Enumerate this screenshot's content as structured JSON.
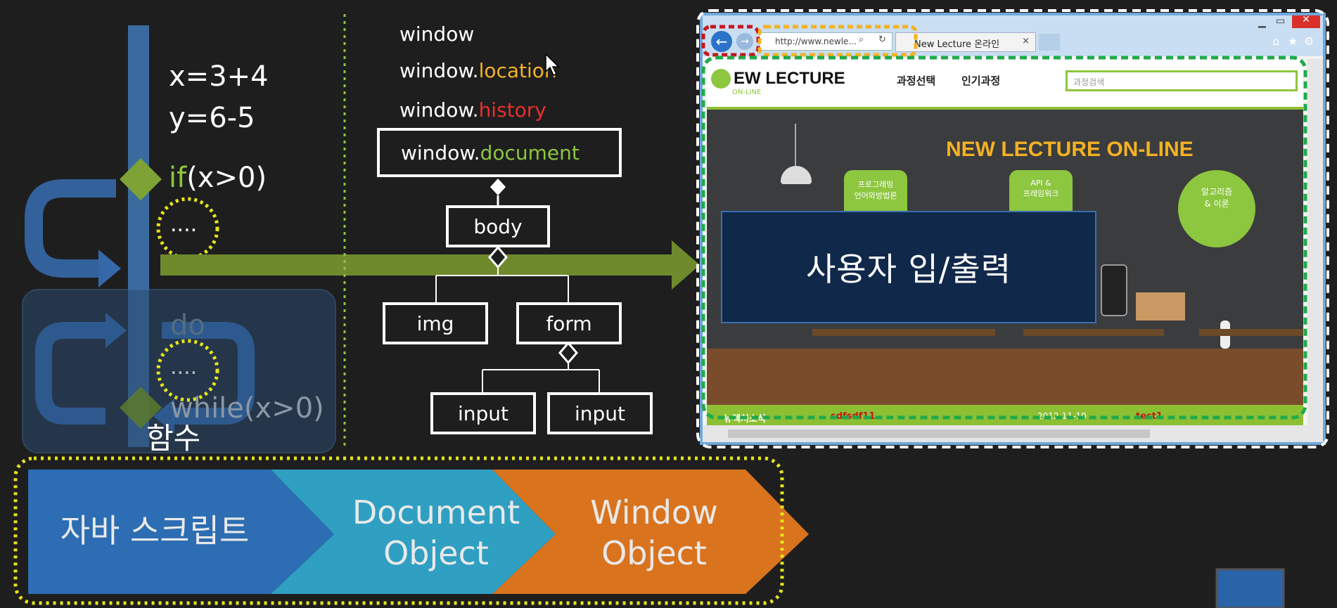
{
  "left_panel": {
    "assign_x": "x=3+4",
    "assign_y": "y=6-5",
    "if_keyword": "if",
    "if_condition": "(x>0)",
    "ellipsis_1": "....",
    "do_keyword": "do",
    "ellipsis_2": "....",
    "while_text": "while(x>0)",
    "function_label": "함수"
  },
  "dom_tree": {
    "window": "window",
    "window_location_prefix": "window.",
    "window_location_suffix": "location",
    "window_history_prefix": "window.",
    "window_history_suffix": "history",
    "window_document_prefix": "window.",
    "window_document_suffix": "document",
    "body": "body",
    "img": "img",
    "form": "form",
    "input_1": "input",
    "input_2": "input"
  },
  "browser": {
    "address": "http://www.newle...",
    "tab_title": "New Lecture 온라인",
    "site_logo_main": "EW LECTURE",
    "site_logo_sub": "ON-LINE",
    "nav_1": "과정선택",
    "nav_2": "인기과정",
    "search_placeholder": "과정검색",
    "banner_title": "NEW LECTURE ON-LINE",
    "bubble_1": "프로그래밍\n언어와방법론",
    "bubble_2": "API &\n프레임워크",
    "bubble_3": "알고리즘\n& 이론",
    "footer_news": "뉴렉처소식",
    "footer_item_1": "sdfsdf11",
    "footer_date": "2012-11-10",
    "footer_item_2": "test1"
  },
  "popup_label": "사용자 입/출력",
  "bottom_flow": {
    "step_1": "자바 스크립트",
    "step_2": "Document\nObject",
    "step_3": "Window\nObject"
  },
  "colors": {
    "location": "#f4b223",
    "history": "#e8302b",
    "document": "#8dc63f",
    "if_keyword": "#8dc63f",
    "dotted_yellow": "#e6e619",
    "arrow_green": "#6f8a2c",
    "chevron_blue": "#2d6db3",
    "chevron_teal": "#2f9fc2",
    "chevron_orange": "#d9731e"
  },
  "icons": [
    "back-arrow-icon",
    "forward-arrow-icon",
    "search-icon",
    "refresh-icon",
    "close-icon",
    "home-icon",
    "star-icon",
    "gear-icon",
    "minimize-icon",
    "maximize-icon"
  ]
}
